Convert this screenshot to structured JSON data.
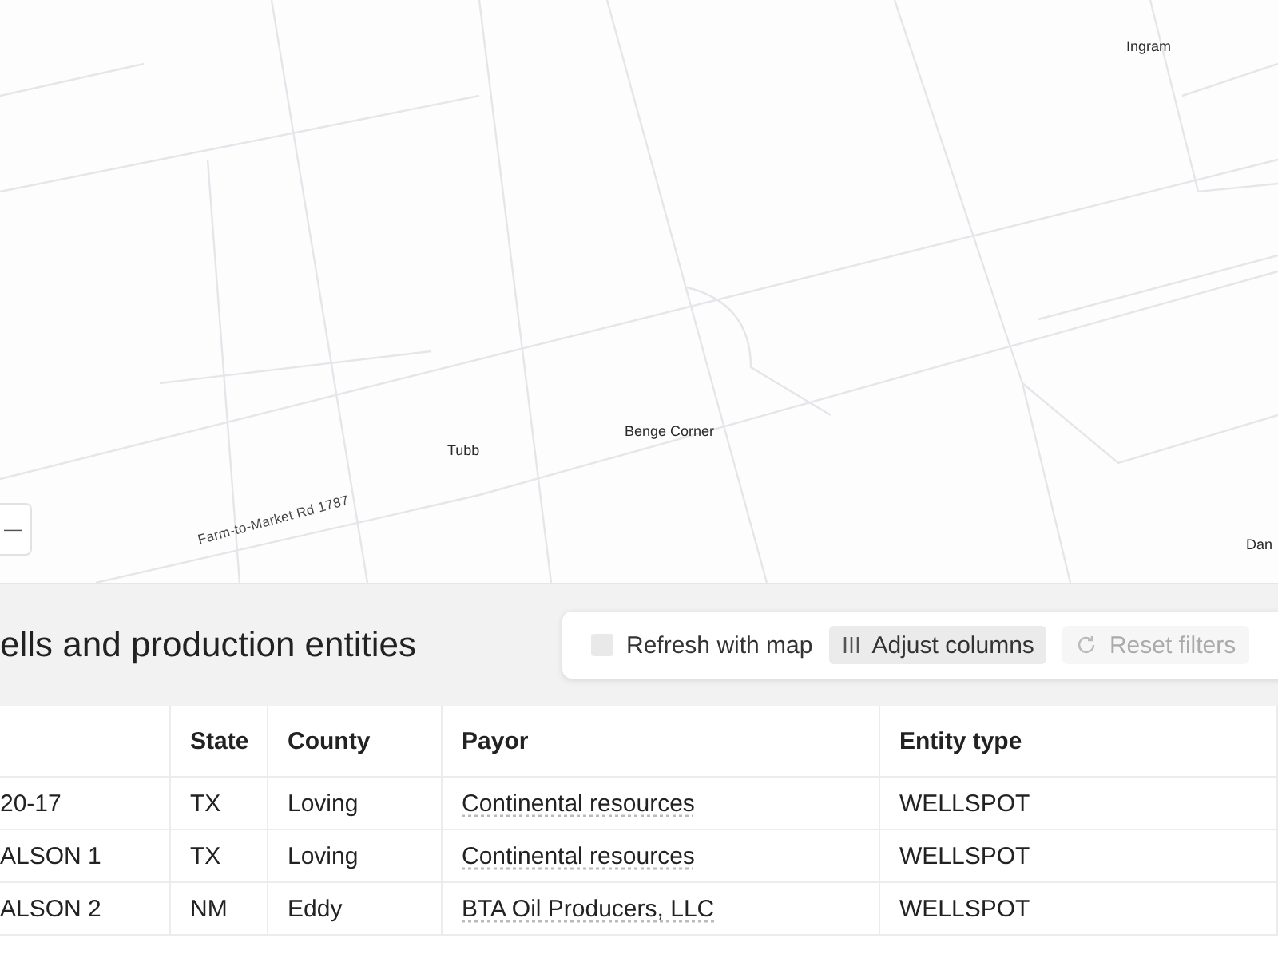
{
  "map": {
    "labels": [
      {
        "text": "Ingram",
        "kind": "place"
      },
      {
        "text": "Tubb",
        "kind": "place"
      },
      {
        "text": "Benge Corner",
        "kind": "place"
      },
      {
        "text": "Farm-to-Market Rd 1787",
        "kind": "road"
      },
      {
        "text": "Dan",
        "kind": "place"
      }
    ],
    "zoom_out": "—"
  },
  "title": "ells and production entities",
  "toolbar": {
    "refresh": {
      "label": "Refresh with map",
      "checked": false
    },
    "adjust": {
      "label": "Adjust columns"
    },
    "reset": {
      "label": "Reset filters",
      "disabled": true
    }
  },
  "table": {
    "columns": [
      "",
      "State",
      "County",
      "Payor",
      "Entity type"
    ],
    "rows": [
      [
        "20-17",
        "TX",
        "Loving",
        "Continental resources",
        "WELLSPOT"
      ],
      [
        "ALSON 1",
        "TX",
        "Loving",
        "Continental resources",
        "WELLSPOT"
      ],
      [
        "ALSON 2",
        "NM",
        "Eddy",
        "BTA Oil Producers, LLC",
        "WELLSPOT"
      ]
    ]
  }
}
